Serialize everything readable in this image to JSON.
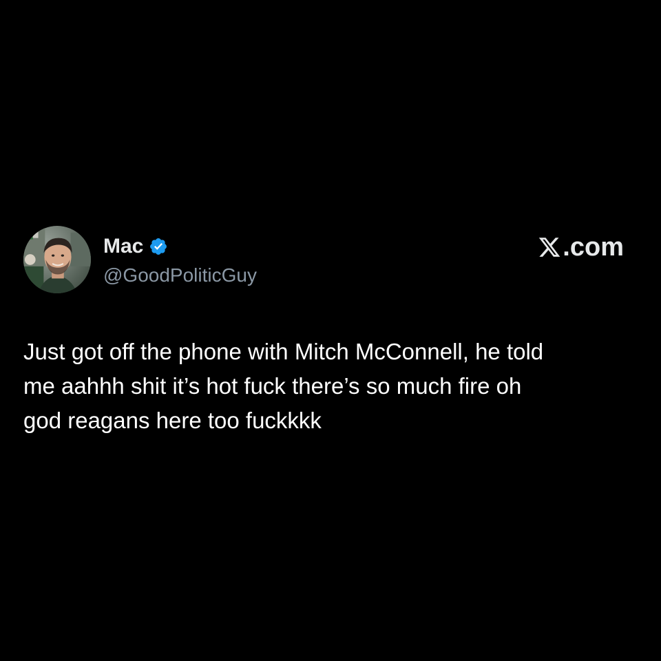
{
  "post": {
    "author": {
      "display_name": "Mac",
      "handle": "@GoodPoliticGuy",
      "verified": true,
      "verified_color": "#1d9bf0",
      "avatar_icon": "avatar-photo"
    },
    "site": {
      "logo_icon": "x-logo-icon",
      "domain_suffix": ".com"
    },
    "text": "Just got off the phone with Mitch McConnell, he told\nme aahhh shit it’s hot fuck there’s so much fire oh\ngod reagans here too fuckkkk"
  },
  "colors": {
    "background": "#000000",
    "primary_text": "#e7e9ea",
    "secondary_text": "#8b98a5"
  }
}
